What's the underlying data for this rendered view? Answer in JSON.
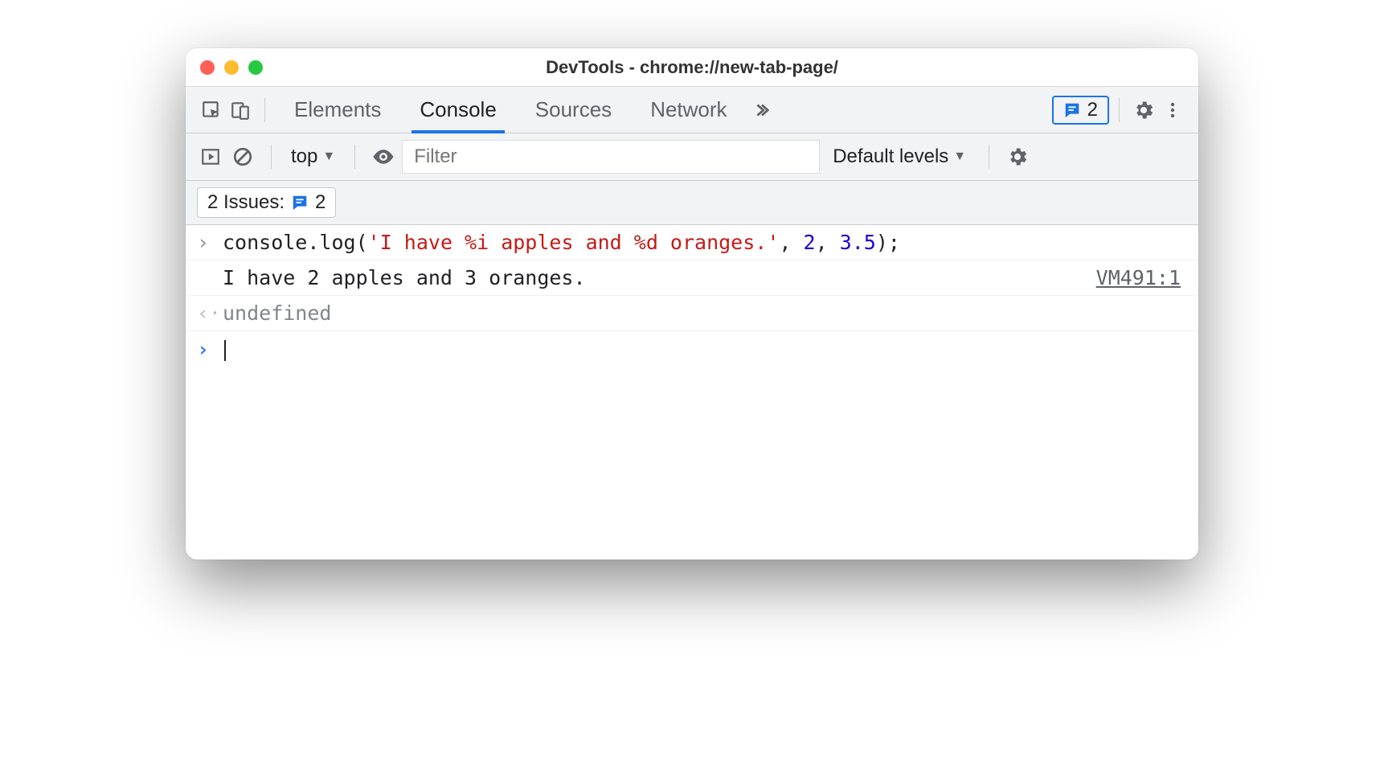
{
  "window": {
    "title": "DevTools - chrome://new-tab-page/"
  },
  "tabs": {
    "elements": "Elements",
    "console": "Console",
    "sources": "Sources",
    "network": "Network"
  },
  "issues_badge": {
    "count": "2"
  },
  "toolbar": {
    "context": "top",
    "filter_placeholder": "Filter",
    "levels": "Default levels"
  },
  "issues_row": {
    "label": "2 Issues:",
    "count": "2"
  },
  "console": {
    "input": {
      "fn": "console.log",
      "open": "(",
      "str": "'I have %i apples and %d oranges.'",
      "comma1": ", ",
      "arg1": "2",
      "comma2": ", ",
      "arg2": "3.5",
      "close": ");"
    },
    "output_text": "I have 2 apples and 3 oranges.",
    "output_source": "VM491:1",
    "return_value": "undefined"
  }
}
